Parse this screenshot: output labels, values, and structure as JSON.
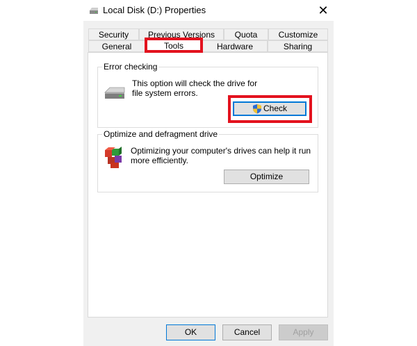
{
  "window": {
    "title": "Local Disk (D:) Properties",
    "close_symbol": "✕",
    "icon": "drive-icon"
  },
  "tabs": {
    "row1": [
      "Security",
      "Previous Versions",
      "Quota",
      "Customize"
    ],
    "row2": [
      "General",
      "Tools",
      "Hardware",
      "Sharing"
    ],
    "active": "Tools"
  },
  "error_checking": {
    "legend": "Error checking",
    "description": "This option will check the drive for file system errors.",
    "button_label": "Check",
    "icon": "drive-icon",
    "button_icon": "uac-shield-icon"
  },
  "optimize": {
    "legend": "Optimize and defragment drive",
    "description": "Optimizing your computer's drives can help it run more efficiently.",
    "button_label": "Optimize",
    "icon": "defrag-icon"
  },
  "footer": {
    "ok": "OK",
    "cancel": "Cancel",
    "apply": "Apply"
  },
  "colors": {
    "highlight": "#e3121e",
    "focus": "#0078d7"
  }
}
